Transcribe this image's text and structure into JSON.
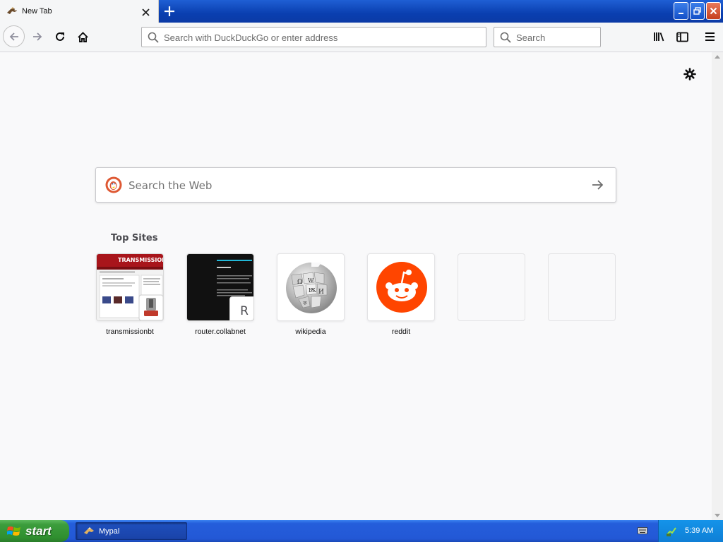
{
  "window": {
    "tab_title": "New Tab",
    "colors": {
      "titlebar": "#0a3fb0",
      "close_button": "#c6401d"
    }
  },
  "toolbar": {
    "url_placeholder": "Search with DuckDuckGo or enter address",
    "search_placeholder": "Search"
  },
  "newtab": {
    "web_search_placeholder": "Search the Web",
    "top_sites_title": "Top Sites",
    "top_sites": [
      {
        "label": "transmissionbt"
      },
      {
        "label": "router.collabnet",
        "fallback_letter": "R"
      },
      {
        "label": "wikipedia"
      },
      {
        "label": "reddit"
      },
      {
        "label": ""
      },
      {
        "label": ""
      }
    ],
    "colors": {
      "reddit": "#ff4500"
    }
  },
  "taskbar": {
    "start_label": "start",
    "task_label": "Mypal",
    "clock": "5:39 AM"
  }
}
